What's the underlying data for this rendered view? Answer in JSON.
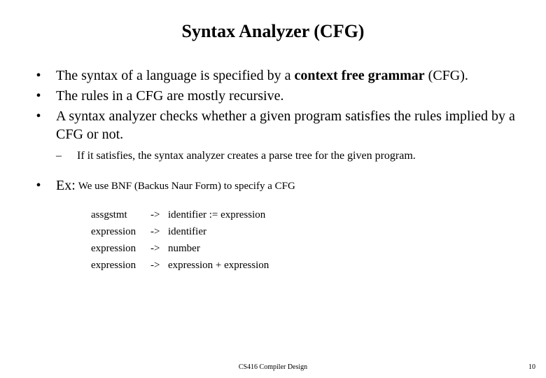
{
  "title": "Syntax Analyzer (CFG)",
  "bullets": {
    "b1_pre": "The syntax of a language is specified by a ",
    "b1_bold": "context free grammar",
    "b1_post": " (CFG).",
    "b2": "The rules in a CFG are mostly recursive.",
    "b3": "A syntax analyzer checks whether a given program satisfies the rules implied by a CFG or not."
  },
  "sub1": "If it satisfies, the syntax analyzer creates a parse tree for the given program.",
  "ex_label": "Ex:",
  "ex_desc": "We use BNF (Backus Naur Form) to specify a CFG",
  "grammar": [
    {
      "lhs": "assgstmt",
      "arrow": "->",
      "rhs": "identifier := expression"
    },
    {
      "lhs": "expression",
      "arrow": "->",
      "rhs": "identifier"
    },
    {
      "lhs": "expression",
      "arrow": "->",
      "rhs": "number"
    },
    {
      "lhs": "expression",
      "arrow": "->",
      "rhs": "expression + expression"
    }
  ],
  "footer": "CS416 Compiler Design",
  "page": "10",
  "dot": "•",
  "dash": "–"
}
